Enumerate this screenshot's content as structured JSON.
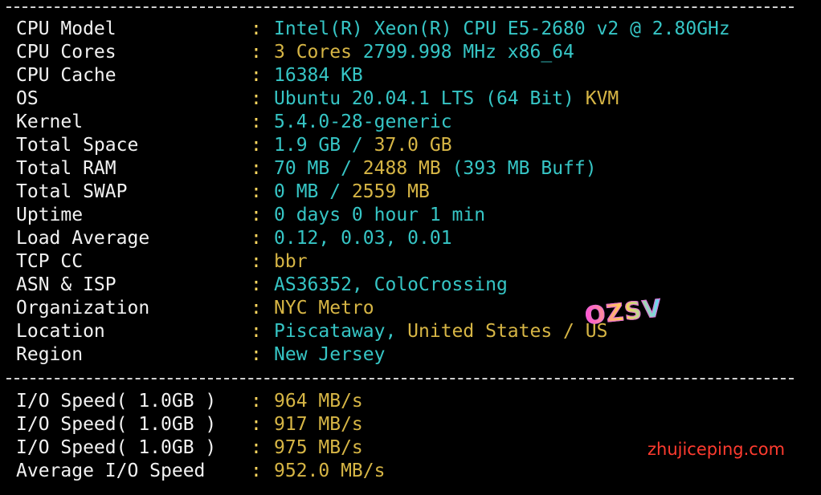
{
  "system_info": [
    {
      "label": "CPU Model",
      "value": [
        {
          "text": "Intel(R) Xeon(R) CPU E5-2680 v2 @ 2.80GHz",
          "tone": "c"
        }
      ]
    },
    {
      "label": "CPU Cores",
      "value": [
        {
          "text": "3 Cores ",
          "tone": "y"
        },
        {
          "text": "2799.998 MHz x86_64",
          "tone": "c"
        }
      ]
    },
    {
      "label": "CPU Cache",
      "value": [
        {
          "text": "16384 KB",
          "tone": "c"
        }
      ]
    },
    {
      "label": "OS",
      "value": [
        {
          "text": "Ubuntu 20.04.1 LTS (64 Bit) ",
          "tone": "c"
        },
        {
          "text": "KVM",
          "tone": "y"
        }
      ]
    },
    {
      "label": "Kernel",
      "value": [
        {
          "text": "5.4.0-28-generic",
          "tone": "c"
        }
      ]
    },
    {
      "label": "Total Space",
      "value": [
        {
          "text": "1.9 GB / ",
          "tone": "c"
        },
        {
          "text": "37.0 GB",
          "tone": "y"
        }
      ]
    },
    {
      "label": "Total RAM",
      "value": [
        {
          "text": "70 MB / ",
          "tone": "c"
        },
        {
          "text": "2488 MB",
          "tone": "y"
        },
        {
          "text": " (393 MB Buff)",
          "tone": "c"
        }
      ]
    },
    {
      "label": "Total SWAP",
      "value": [
        {
          "text": "0 MB / ",
          "tone": "c"
        },
        {
          "text": "2559 MB",
          "tone": "y"
        }
      ]
    },
    {
      "label": "Uptime",
      "value": [
        {
          "text": "0 days 0 hour 1 min",
          "tone": "c"
        }
      ]
    },
    {
      "label": "Load Average",
      "value": [
        {
          "text": "0.12, 0.03, 0.01",
          "tone": "c"
        }
      ]
    },
    {
      "label": "TCP CC",
      "value": [
        {
          "text": "bbr",
          "tone": "y"
        }
      ]
    },
    {
      "label": "ASN & ISP",
      "value": [
        {
          "text": "AS36352, ColoCrossing",
          "tone": "c"
        }
      ]
    },
    {
      "label": "Organization",
      "value": [
        {
          "text": "NYC Metro",
          "tone": "y"
        }
      ]
    },
    {
      "label": "Location",
      "value": [
        {
          "text": "Piscataway, ",
          "tone": "c"
        },
        {
          "text": "United States / US",
          "tone": "y"
        }
      ]
    },
    {
      "label": "Region",
      "value": [
        {
          "text": "New Jersey",
          "tone": "c"
        }
      ]
    }
  ],
  "io_info": [
    {
      "label": "I/O Speed( 1.0GB )",
      "value": [
        {
          "text": "964 MB/s",
          "tone": "y"
        }
      ]
    },
    {
      "label": "I/O Speed( 1.0GB )",
      "value": [
        {
          "text": "917 MB/s",
          "tone": "y"
        }
      ]
    },
    {
      "label": "I/O Speed( 1.0GB )",
      "value": [
        {
          "text": "975 MB/s",
          "tone": "y"
        }
      ]
    },
    {
      "label": "Average I/O Speed",
      "value": [
        {
          "text": "952.0 MB/s",
          "tone": "y"
        }
      ]
    }
  ],
  "separator": ":",
  "watermark": {
    "logo_text": "OZSV",
    "site_text": "zhujiceping.com"
  },
  "colors": {
    "background": "#000000",
    "label": "#f2f2f2",
    "cyan": "#36c5c5",
    "yellow": "#d6b545",
    "watermark_red": "#ff3b2f"
  }
}
